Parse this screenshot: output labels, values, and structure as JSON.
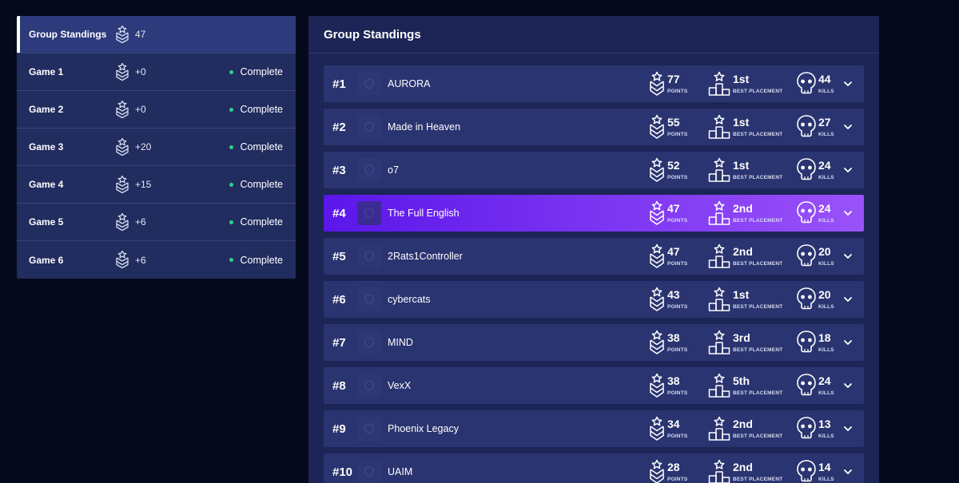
{
  "sidebar": {
    "items": [
      {
        "label": "Group Standings",
        "points": "47",
        "status": "",
        "active": true
      },
      {
        "label": "Game 1",
        "points": "+0",
        "status": "Complete",
        "active": false
      },
      {
        "label": "Game 2",
        "points": "+0",
        "status": "Complete",
        "active": false
      },
      {
        "label": "Game 3",
        "points": "+20",
        "status": "Complete",
        "active": false
      },
      {
        "label": "Game 4",
        "points": "+15",
        "status": "Complete",
        "active": false
      },
      {
        "label": "Game 5",
        "points": "+6",
        "status": "Complete",
        "active": false
      },
      {
        "label": "Game 6",
        "points": "+6",
        "status": "Complete",
        "active": false
      }
    ]
  },
  "main": {
    "title": "Group Standings",
    "labels": {
      "points": "POINTS",
      "placement": "BEST PLACEMENT",
      "kills": "KILLS"
    },
    "standings": [
      {
        "rank": "#1",
        "team": "AURORA",
        "points": "77",
        "placement": "1st",
        "kills": "44"
      },
      {
        "rank": "#2",
        "team": "Made in Heaven",
        "points": "55",
        "placement": "1st",
        "kills": "27"
      },
      {
        "rank": "#3",
        "team": "o7",
        "points": "52",
        "placement": "1st",
        "kills": "24"
      },
      {
        "rank": "#4",
        "team": "The Full English",
        "points": "47",
        "placement": "2nd",
        "kills": "24",
        "highlight": true
      },
      {
        "rank": "#5",
        "team": "2Rats1Controller",
        "points": "47",
        "placement": "2nd",
        "kills": "20"
      },
      {
        "rank": "#6",
        "team": "cybercats",
        "points": "43",
        "placement": "1st",
        "kills": "20"
      },
      {
        "rank": "#7",
        "team": "MIND",
        "points": "38",
        "placement": "3rd",
        "kills": "18"
      },
      {
        "rank": "#8",
        "team": "VexX",
        "points": "38",
        "placement": "5th",
        "kills": "24"
      },
      {
        "rank": "#9",
        "team": "Phoenix Legacy",
        "points": "34",
        "placement": "2nd",
        "kills": "13"
      },
      {
        "rank": "#10",
        "team": "UAIM",
        "points": "28",
        "placement": "2nd",
        "kills": "14"
      }
    ]
  },
  "colors": {
    "background": "#040a1c",
    "panel": "#1c2556",
    "sidebar": "#212c5f",
    "row": "#2a3470",
    "highlight_start": "#5b16ea",
    "highlight_end": "#9a52f8",
    "status_complete": "#2ed08a"
  },
  "icons": {
    "points": "chevron-badge-icon",
    "placement": "podium-star-icon",
    "kills": "skull-icon",
    "expand": "chevron-down-icon",
    "team_logo": "shield-icon"
  }
}
